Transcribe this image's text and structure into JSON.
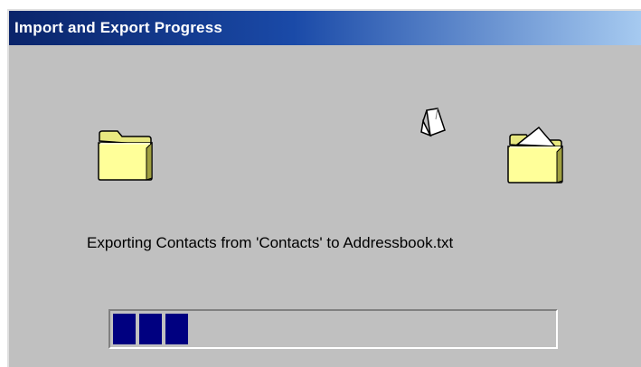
{
  "window": {
    "title": "Import and Export Progress"
  },
  "icons": {
    "source": "folder-icon",
    "destination": "open-folder-icon",
    "animation": "flying-document-icon"
  },
  "status": {
    "message": "Exporting Contacts from 'Contacts' to Addressbook.txt"
  },
  "progress": {
    "blocks_filled": 3,
    "percent": 17
  },
  "colors": {
    "title_start": "#0a246a",
    "title_end": "#a6caf0",
    "dialog_bg": "#c0c0c0",
    "progress_fill": "#000080",
    "folder_yellow": "#ffff99"
  }
}
